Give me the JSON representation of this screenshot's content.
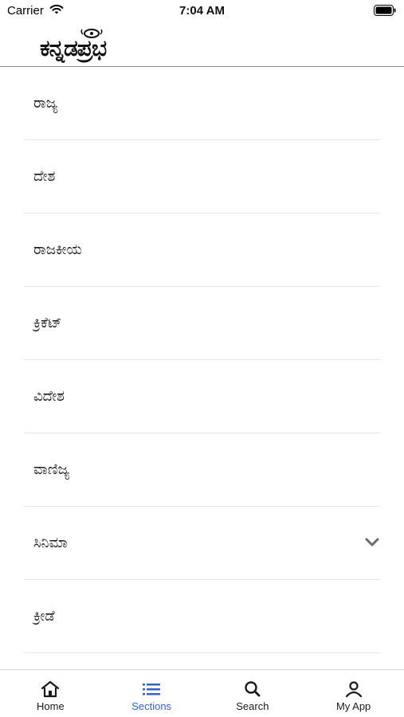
{
  "status_bar": {
    "carrier": "Carrier",
    "time": "7:04 AM"
  },
  "header": {
    "logo_text": "ಕನ್ನಡಪ್ರಭ"
  },
  "sections": [
    {
      "label": "ರಾಜ್ಯ",
      "expandable": false
    },
    {
      "label": "ದೇಶ",
      "expandable": false
    },
    {
      "label": "ರಾಜಕೀಯ",
      "expandable": false
    },
    {
      "label": "ಕ್ರಿಕೆಟ್",
      "expandable": false
    },
    {
      "label": "ವಿದೇಶ",
      "expandable": false
    },
    {
      "label": "ವಾಣಿಜ್ಯ",
      "expandable": false
    },
    {
      "label": "ಸಿನಿಮಾ",
      "expandable": true
    },
    {
      "label": "ಕ್ರೀಡೆ",
      "expandable": false
    }
  ],
  "tab_bar": {
    "tabs": [
      {
        "label": "Home",
        "icon": "home-icon",
        "active": false
      },
      {
        "label": "Sections",
        "icon": "list-icon",
        "active": true
      },
      {
        "label": "Search",
        "icon": "search-icon",
        "active": false
      },
      {
        "label": "My App",
        "icon": "person-icon",
        "active": false
      }
    ]
  },
  "colors": {
    "accent": "#2e64c6",
    "divider": "#e6e6e6",
    "chevron": "#6b6b6b"
  }
}
